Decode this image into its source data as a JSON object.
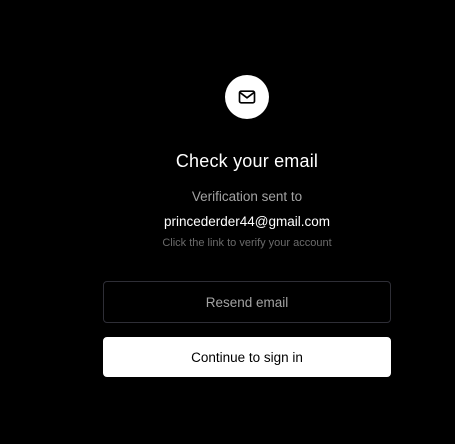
{
  "verify": {
    "icon": "mail-icon",
    "title": "Check your email",
    "sent_label": "Verification sent to",
    "email": "princederder44@gmail.com",
    "hint": "Click the link to verify your account",
    "resend_label": "Resend email",
    "continue_label": "Continue to sign in"
  },
  "colors": {
    "background": "#000000",
    "primary_button_bg": "#ffffff",
    "secondary_button_border": "#2e2e36",
    "muted_text": "#a3a3a3",
    "hint_text": "#6b6b6b"
  }
}
